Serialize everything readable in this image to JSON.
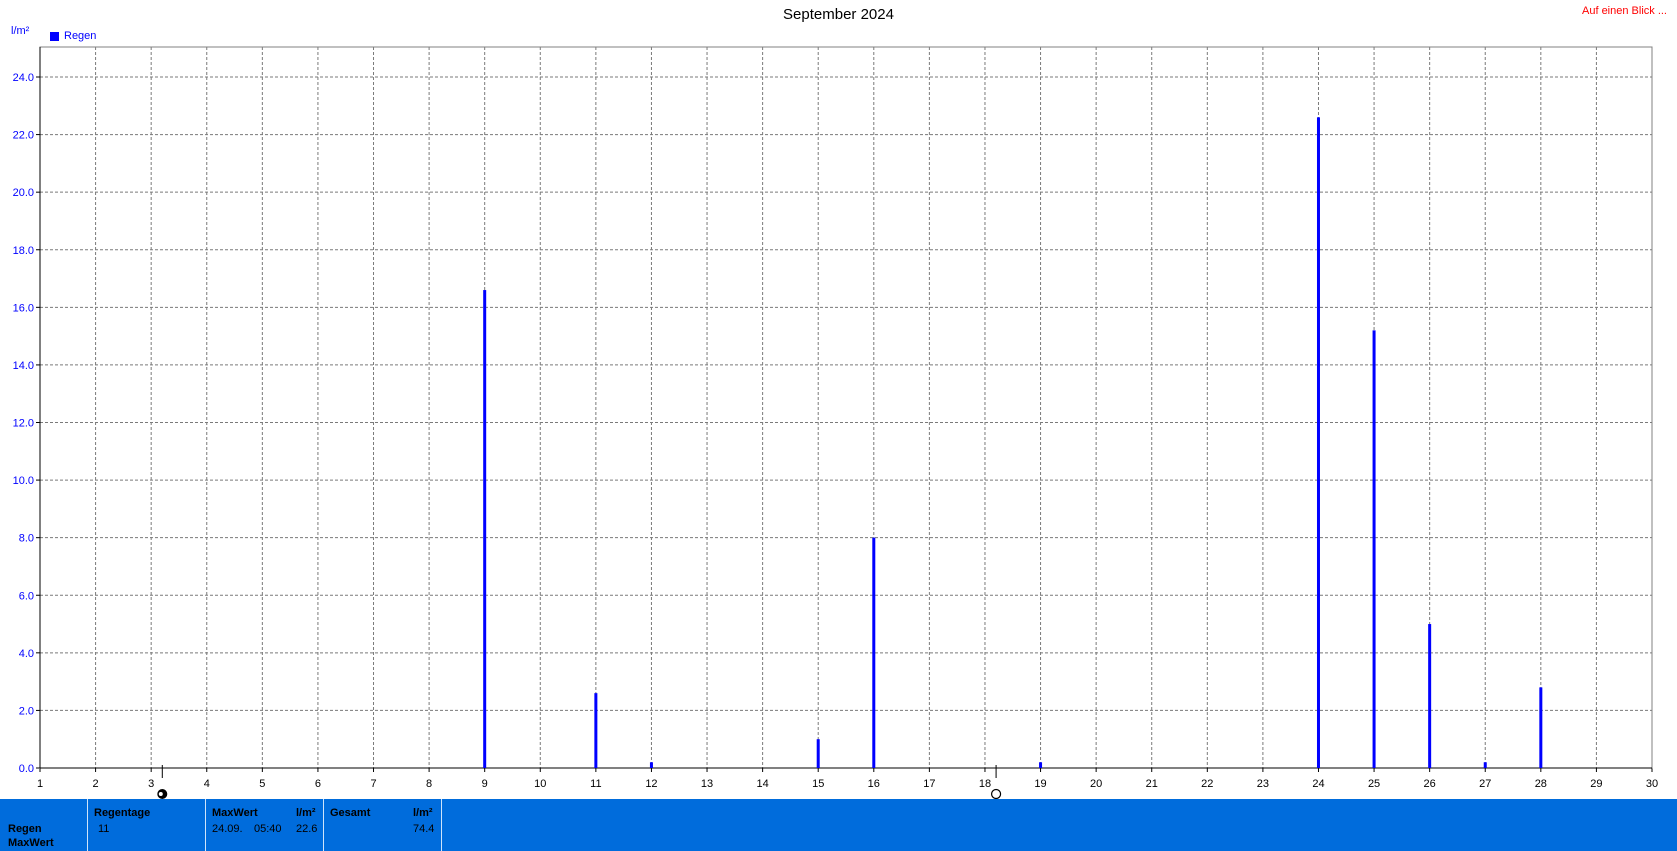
{
  "header": {
    "title": "September 2024",
    "top_link": "Auf einen Blick ..."
  },
  "legend": {
    "label": "Regen",
    "color": "#0000ff"
  },
  "y_unit": "l/m²",
  "chart_data": {
    "type": "bar",
    "title": "September 2024",
    "xlabel": "",
    "ylabel": "l/m²",
    "xlim": [
      1,
      30
    ],
    "ylim": [
      0,
      25
    ],
    "y_ticks": [
      "0.0",
      "2.0",
      "4.0",
      "6.0",
      "8.0",
      "10.0",
      "12.0",
      "14.0",
      "16.0",
      "18.0",
      "20.0",
      "22.0",
      "24.0"
    ],
    "x_ticks": [
      "1",
      "2",
      "3",
      "4",
      "5",
      "6",
      "7",
      "8",
      "9",
      "10",
      "11",
      "12",
      "13",
      "14",
      "15",
      "16",
      "17",
      "18",
      "19",
      "20",
      "21",
      "22",
      "23",
      "24",
      "25",
      "26",
      "27",
      "28",
      "29",
      "30"
    ],
    "grid": true,
    "legend_position": "top-left",
    "series": [
      {
        "name": "Regen",
        "color": "#0000ff",
        "x": [
          9,
          11,
          12,
          15,
          16,
          19,
          24,
          25,
          26,
          27,
          28
        ],
        "values": [
          16.6,
          2.6,
          0.2,
          1.0,
          8.0,
          0.2,
          22.6,
          15.2,
          5.0,
          0.2,
          2.8
        ]
      }
    ],
    "moon_markers": [
      {
        "day": 3.2,
        "phase": "new-moon"
      },
      {
        "day": 18.2,
        "phase": "full-moon"
      }
    ]
  },
  "stats": {
    "row_labels": [
      "Regen",
      "MaxWert"
    ],
    "regentage": {
      "label": "Regentage",
      "value": "11"
    },
    "maxwert": {
      "label": "MaxWert",
      "unit": "l/m²",
      "date": "24.09.",
      "time": "05:40",
      "value": "22.6"
    },
    "gesamt": {
      "label": "Gesamt",
      "unit": "l/m²",
      "value": "74.4"
    }
  }
}
